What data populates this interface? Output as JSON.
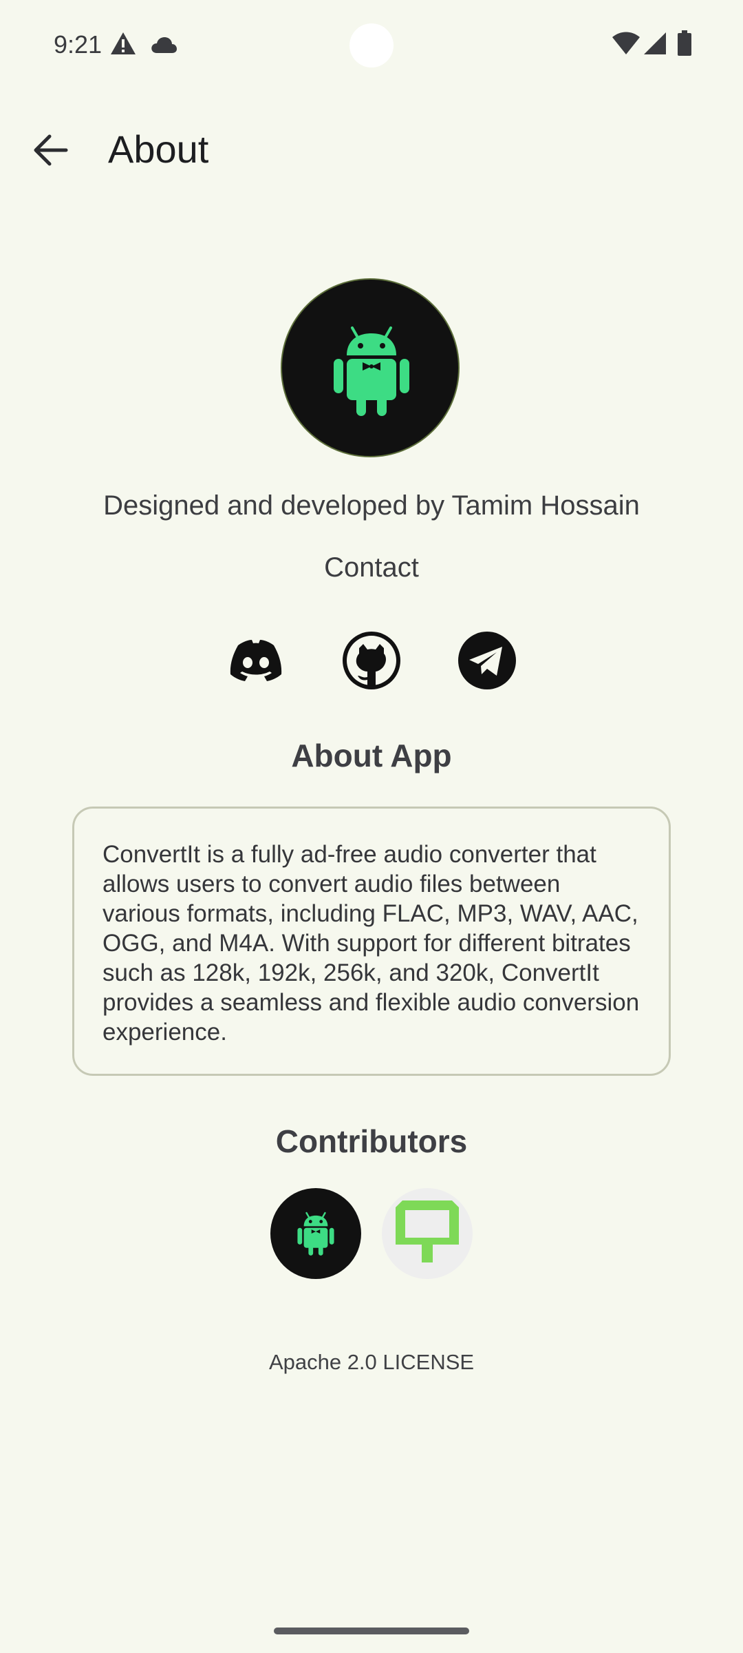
{
  "status_bar": {
    "time": "9:21",
    "left_icons": [
      "warning-icon",
      "cloud-icon"
    ],
    "right_icons": [
      "wifi-icon",
      "signal-icon",
      "battery-icon"
    ]
  },
  "app_bar": {
    "back_icon": "arrow-back-icon",
    "title": "About"
  },
  "profile": {
    "avatar_icon": "android-robot-icon",
    "designer_text": "Designed and developed by Tamim Hossain",
    "contact_label": "Contact",
    "social_links": [
      {
        "icon": "discord-icon"
      },
      {
        "icon": "github-icon"
      },
      {
        "icon": "telegram-icon"
      }
    ]
  },
  "about_app": {
    "heading": "About App",
    "description": "ConvertIt is a fully ad-free audio converter that allows users to convert audio files between various formats, including FLAC, MP3, WAV, AAC, OGG, and M4A. With support for different bitrates such as 128k, 192k, 256k, and 320k, ConvertIt provides a seamless and flexible audio conversion experience."
  },
  "contributors": {
    "heading": "Contributors",
    "avatars": [
      "android-robot-icon",
      "pixel-monitor-icon"
    ]
  },
  "license": "Apache 2.0 LICENSE",
  "colors": {
    "background": "#f6f8ee",
    "android_green": "#3ddc84",
    "avatar_black": "#111111",
    "contributor_green": "#7ed957"
  }
}
